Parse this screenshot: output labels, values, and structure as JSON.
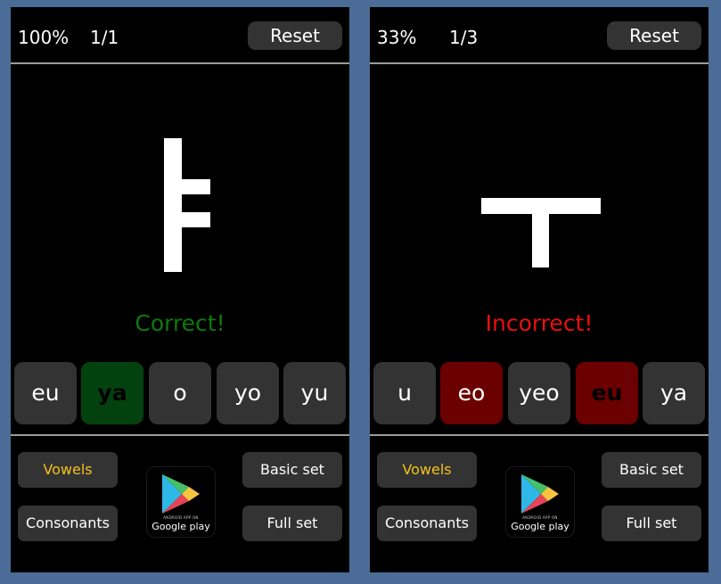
{
  "colors": {
    "background": "#4a6c96",
    "panel": "#000000",
    "button": "#333333",
    "correct_text": "#0d7a0d",
    "incorrect_text": "#e81010",
    "correct_fill": "#03420e",
    "wrong_fill": "#6b0000",
    "active_mode": "#f2c21b"
  },
  "panels": [
    {
      "score": "100%",
      "progress": "1/1",
      "reset_label": "Reset",
      "glyph": "ㅑ",
      "feedback": {
        "text": "Correct!",
        "color": "#0d7a0d"
      },
      "answers": [
        {
          "label": "eu",
          "state": "default"
        },
        {
          "label": "ya",
          "state": "correct"
        },
        {
          "label": "o",
          "state": "default"
        },
        {
          "label": "yo",
          "state": "default"
        },
        {
          "label": "yu",
          "state": "default"
        }
      ],
      "modes": {
        "vowels": "Vowels",
        "consonants": "Consonants",
        "active": "vowels"
      },
      "sets": {
        "basic": "Basic set",
        "full": "Full set"
      },
      "store_badge": {
        "icon": "google-play-icon",
        "small_text": "ANDROID APP ON",
        "text": "Google play"
      }
    },
    {
      "score": "33%",
      "progress": "1/3",
      "reset_label": "Reset",
      "glyph": "ㅜ",
      "feedback": {
        "text": "Incorrect!",
        "color": "#e81010"
      },
      "answers": [
        {
          "label": "u",
          "state": "default"
        },
        {
          "label": "eo",
          "state": "wrong"
        },
        {
          "label": "yeo",
          "state": "default"
        },
        {
          "label": "eu",
          "state": "wrong-bold"
        },
        {
          "label": "ya",
          "state": "default"
        }
      ],
      "modes": {
        "vowels": "Vowels",
        "consonants": "Consonants",
        "active": "vowels"
      },
      "sets": {
        "basic": "Basic set",
        "full": "Full set"
      },
      "store_badge": {
        "icon": "google-play-icon",
        "small_text": "ANDROID APP ON",
        "text": "Google play"
      }
    }
  ]
}
